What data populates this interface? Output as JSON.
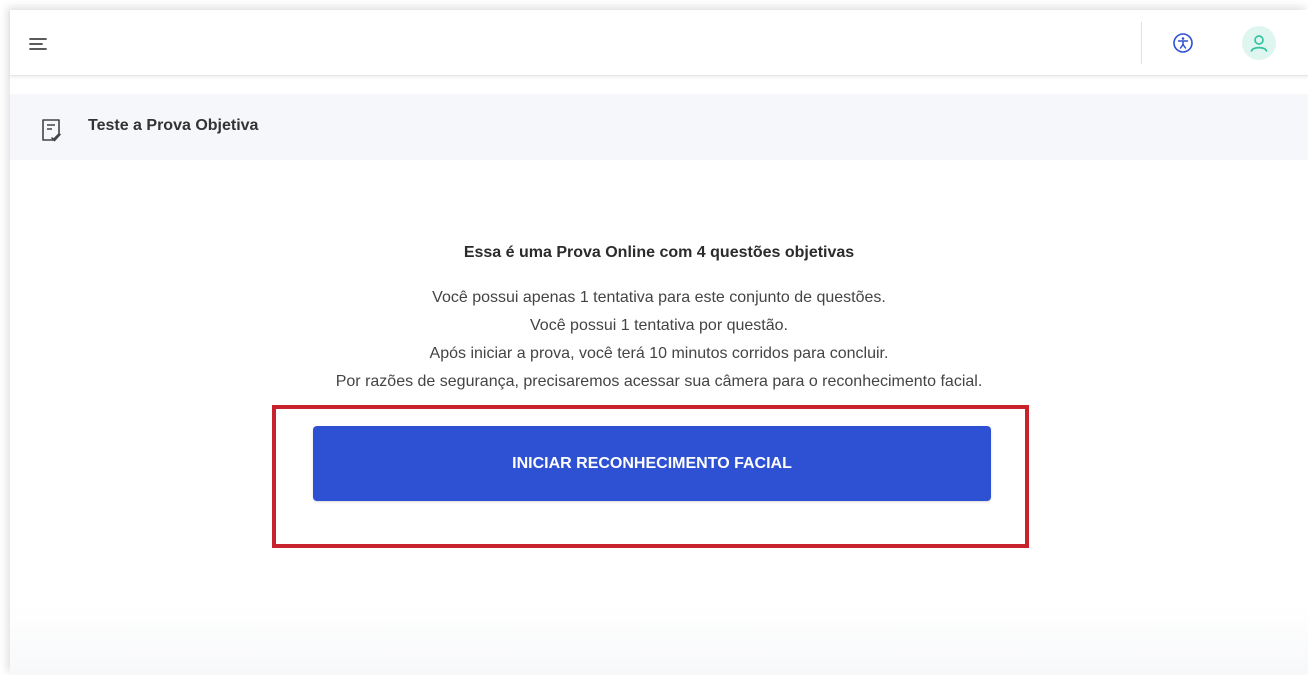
{
  "header": {
    "menu_icon": "hamburger-menu-icon",
    "accessibility_icon": "accessibility-icon",
    "avatar_icon": "user-icon",
    "colors": {
      "avatar_bg": "#dff6f0",
      "avatar_fg": "#35c3a0",
      "accessibility": "#2e50d2"
    }
  },
  "page": {
    "title_icon": "exam-checklist-icon",
    "title": "Teste a Prova Objetiva"
  },
  "exam": {
    "headline": "Essa é uma Prova Online com 4 questões objetivas",
    "lines": [
      "Você possui apenas 1 tentativa para este conjunto de questões.",
      "Você possui 1 tentativa por questão.",
      "Após iniciar a prova, você terá 10 minutos corridos para concluir.",
      "Por razões de segurança, precisaremos acessar sua câmera para o reconhecimento facial."
    ],
    "start_button_label": "INICIAR RECONHECIMENTO FACIAL",
    "colors": {
      "button": "#2e50d2",
      "highlight_border": "#c8232c"
    }
  }
}
